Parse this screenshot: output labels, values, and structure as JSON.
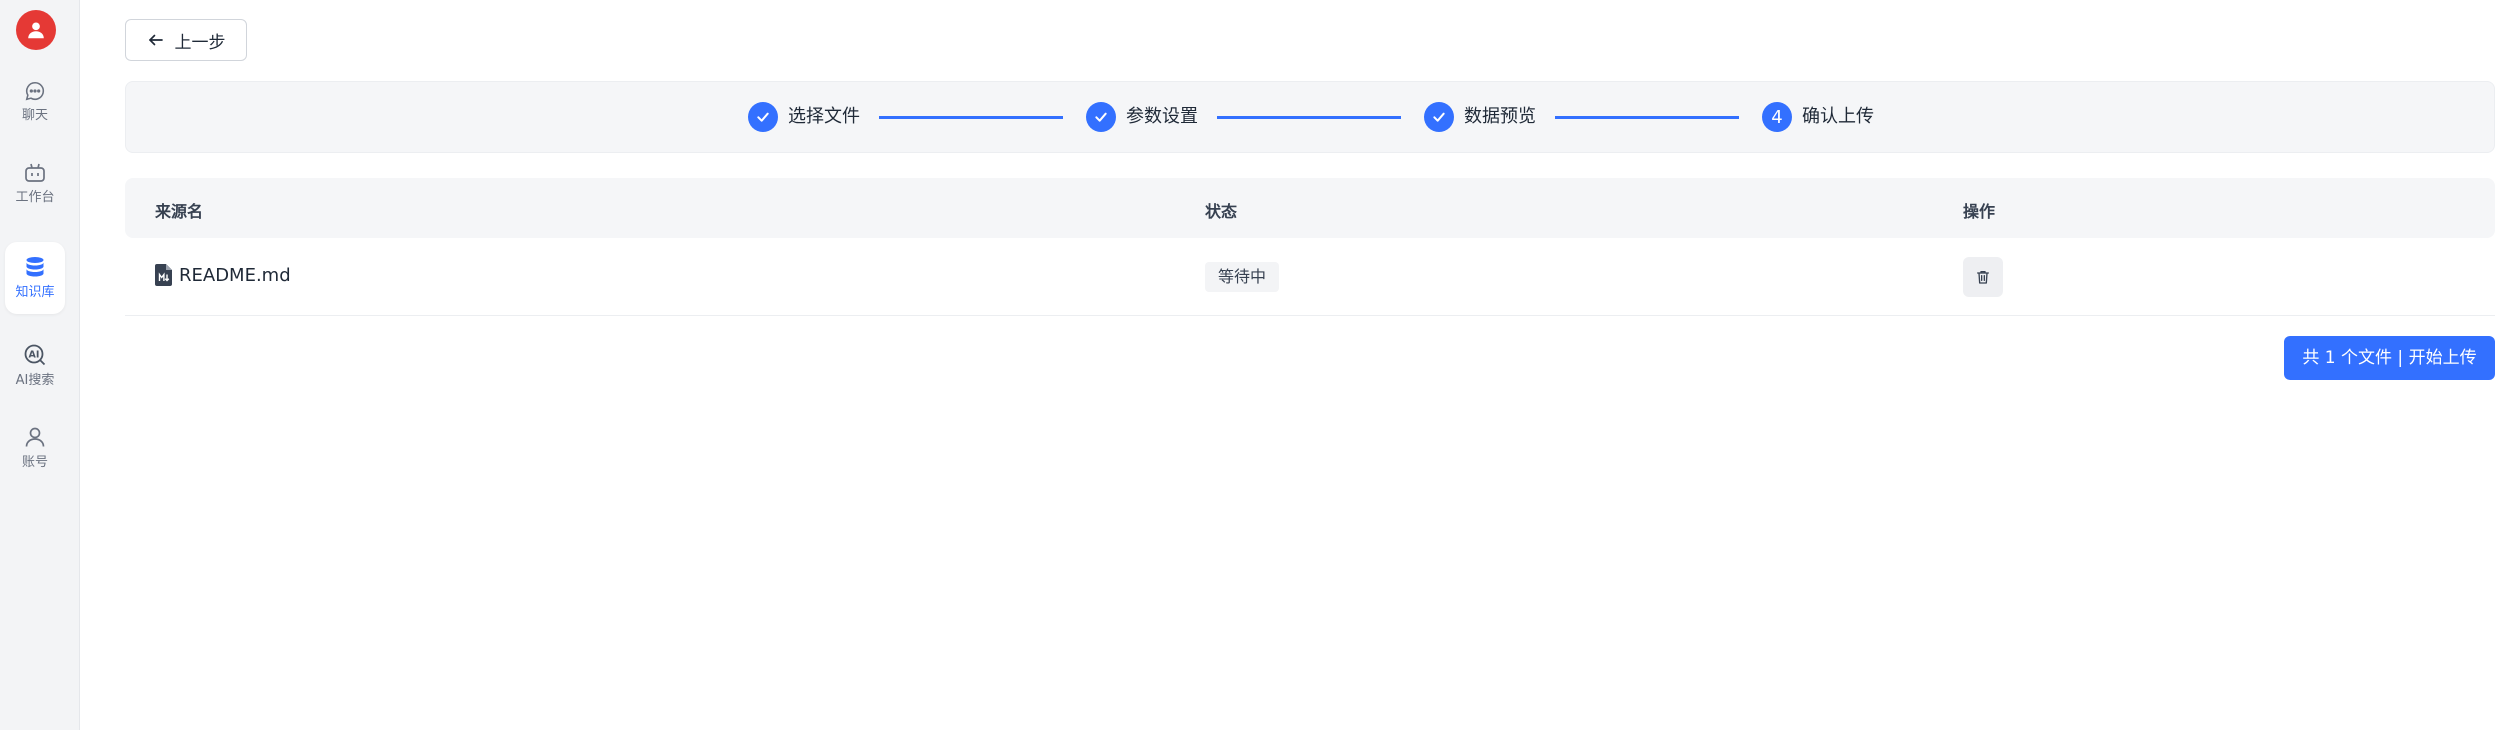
{
  "sidebar": {
    "avatar_icon": "user-avatar-icon",
    "items": [
      {
        "label": "聊天",
        "icon": "chat-bubble-icon",
        "active": false
      },
      {
        "label": "工作台",
        "icon": "robot-icon",
        "active": false
      },
      {
        "label": "知识库",
        "icon": "database-icon",
        "active": true
      },
      {
        "label": "AI搜索",
        "icon": "ai-search-icon",
        "active": false
      },
      {
        "label": "账号",
        "icon": "user-icon",
        "active": false
      }
    ]
  },
  "toolbar": {
    "back_label": "上一步"
  },
  "steps": [
    {
      "label": "选择文件",
      "state": "done"
    },
    {
      "label": "参数设置",
      "state": "done"
    },
    {
      "label": "数据预览",
      "state": "done"
    },
    {
      "label": "确认上传",
      "state": "current",
      "number": "4"
    }
  ],
  "table": {
    "columns": [
      "来源名",
      "状态",
      "操作"
    ],
    "rows": [
      {
        "name": "README.md",
        "status": "等待中"
      }
    ]
  },
  "upload_button_label": "共 1 个文件 | 开始上传",
  "colors": {
    "accent": "#3370ff",
    "avatar": "#e53935",
    "sidebar_bg": "#f3f4f6"
  }
}
